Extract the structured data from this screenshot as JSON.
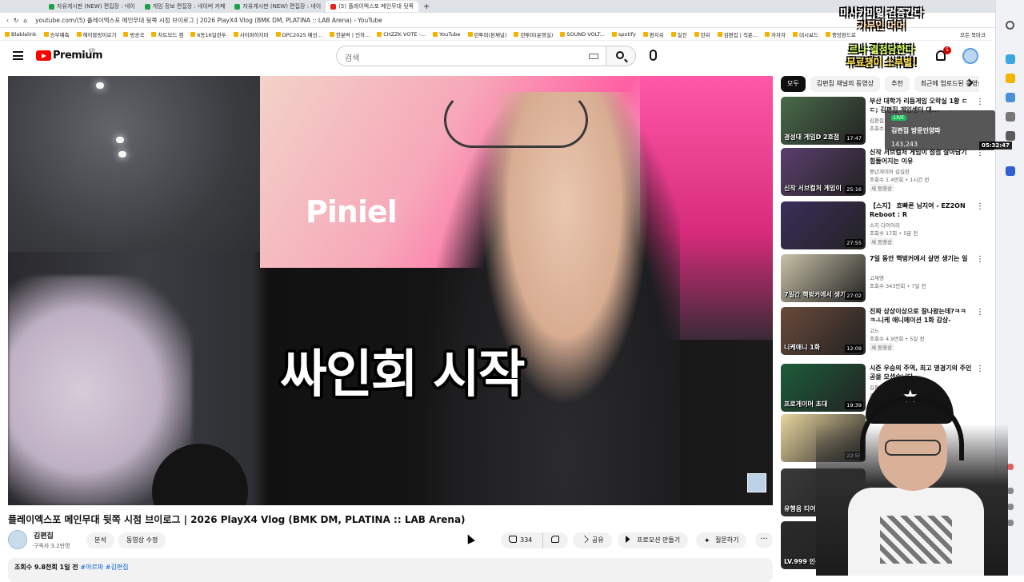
{
  "browser": {
    "tabs": [
      {
        "label": "자유게시판 (NEW) 편집장 : 네이"
      },
      {
        "label": "게임 정보 편집장 : 네이버 카페"
      },
      {
        "label": "자유게시판 (NEW) 편집장 : 네이"
      },
      {
        "label": "(5) 플레이엑스포 메인무대 뒷쪽",
        "active": true
      }
    ],
    "add_tab": "+",
    "address": "youtube.com/(5) 플레이엑스포 메인무대 뒷쪽 시점 브이로그 | 2026 PlayX4 Vlog (BMK DM, PLATINA :: LAB Arena) - YouTube",
    "bookmarks": [
      "Blablalink",
      "승부예측",
      "헤이블링이로기",
      "방송국",
      "차트모드 겜",
      "6동16일련두",
      "사이퍼하지마",
      "DPC2025 예선...",
      "한분딱 | 인하...",
      "CHZZK VOTE -...",
      "YouTube",
      "런투피(본채널)",
      "런투피(운영실)",
      "SOUND VOLT...",
      "spotify",
      "편지쉬",
      "일진",
      "런쉬",
      "김편집 | 직준...",
      "자자자",
      "대시보드",
      "중앙판드로"
    ],
    "bookmarks_more": "모든 북마크"
  },
  "header": {
    "logo_word": "Premium",
    "logo_region": "KR",
    "search_placeholder": "검색",
    "notification_count": "5"
  },
  "video": {
    "poster_text": "Piniel",
    "subtitle": "싸인회 시작",
    "title": "플레이엑스포 메인무대 뒷쪽 시점 브이로그 | 2026 PlayX4 Vlog (BMK DM, PLATINA :: LAB Arena)",
    "channel": "김편집",
    "subscribers": "구독자 3.2만명",
    "buttons": {
      "analytics": "분석",
      "edit": "동영상 수정",
      "likes": "334",
      "share": "공유",
      "promote": "프로모션 만들기",
      "thanks": "질문하기",
      "more": "···"
    },
    "description": {
      "stats": "조회수 9.8천회 1일 전",
      "tags": "#아르파 #김편집"
    }
  },
  "sidebar": {
    "chips": [
      "모두",
      "김편집 채널의 동영상",
      "추천",
      "최근에 업로드된 동영상"
    ],
    "recommendations": [
      {
        "title": "부산 대학가 리듬게임 오락실 1황 ㄷㄷ; 김편집 게임센터 대...",
        "channel": "김편집",
        "meta": "조회수 ...",
        "badge": "",
        "thumb_text": "경성대 게임D 2호점",
        "duration": "17:47",
        "thumb_color": "#4a6b4a"
      },
      {
        "title": "신작 서브컬처 게임이 점점 살아남기 힘들어지는 이유",
        "channel": "중년게이머 김실장",
        "meta": "조회수 1.4만회 • 1시간 전",
        "badge": "새 동영상",
        "thumb_text": "신작 서브컬처 게임이",
        "duration": "25:16",
        "thumb_color": "#5b3f6e"
      },
      {
        "title": "【스지】 흐빠른 님지여 - EZ2ON Reboot : R",
        "channel": "스지 다이어리",
        "meta": "조회수 17회 • 5분 전",
        "badge": "새 동영상",
        "thumb_text": "",
        "duration": "27:55",
        "thumb_color": "#3b2f5c"
      },
      {
        "title": "7일 동안 핵벙커에서 살면 생기는 일",
        "channel": "고재영",
        "meta": "조회수 343만회 • 7일 전",
        "badge": "",
        "thumb_text": "7일간 핵벙커에서 생기",
        "duration": "27:02",
        "thumb_color": "#c9c2a8"
      },
      {
        "title": "진짜 상상이상으로 잘나왔는데?ㅋㅋㅋ-니케 애니메이션 1화 감상-",
        "channel": "고느",
        "meta": "조회수 4.9만회 • 5일 전",
        "badge": "새 동영상",
        "thumb_text": "니케애니 1화",
        "duration": "12:09",
        "thumb_color": "#6a4a3a"
      },
      {
        "title": "시즌 우승의 주역, 최고 명경기의 주인공을 모셨습니다...",
        "channel": "김편집",
        "meta": "조회수 ...",
        "badge": "",
        "thumb_text": "프로게이머 초대",
        "duration": "19:39",
        "thumb_color": "#1d5c3a"
      },
      {
        "title": "",
        "channel": "",
        "meta": "",
        "badge": "",
        "thumb_text": "",
        "duration": "22:55",
        "thumb_color": "#e8d6a0"
      },
      {
        "title": "",
        "channel": "",
        "meta": "",
        "badge": "",
        "thumb_text": "유행음 티어리",
        "duration": "",
        "thumb_color": "#3a3a3a"
      },
      {
        "title": "",
        "channel": "",
        "meta": "",
        "badge": "",
        "thumb_text": "LV.999 인생게임",
        "duration": "",
        "thumb_color": "#2a2a2a"
      }
    ]
  },
  "stream_overlay": {
    "lines": [
      "미사카미일 검증간다",
      "가무인 어어",
      "르나 결정당한다",
      "무료쟁이 소부별!"
    ],
    "widget_live": "LIVE",
    "widget_title": "김편집 방문인양파",
    "widget_viewers": "143,243",
    "widget_time": "05:32:47"
  },
  "colors": {
    "youtube_red": "#ff0000",
    "link_blue": "#065fd4",
    "chip_active": "#0f0f0f"
  }
}
